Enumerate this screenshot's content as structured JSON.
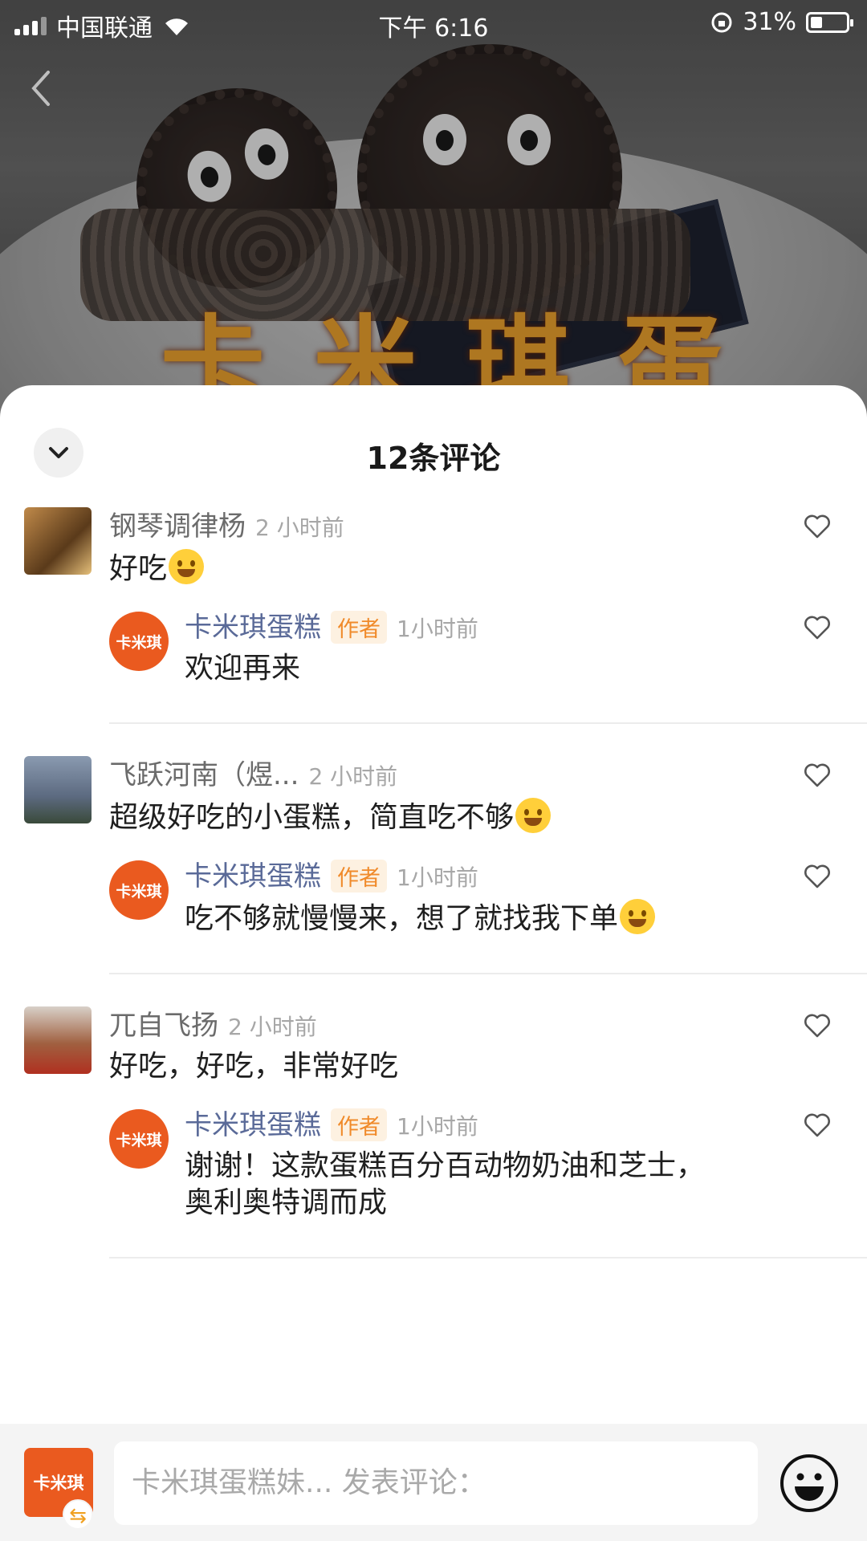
{
  "status_bar": {
    "carrier": "中国联通",
    "time": "下午 6:16",
    "battery": "31%"
  },
  "hero": {
    "brand_overlay": "卡米琪蛋糕"
  },
  "sheet": {
    "title": "12条评论"
  },
  "comments": [
    {
      "user": "钢琴调律杨",
      "time": "2 小时前",
      "text": "好吃",
      "reply": {
        "user": "卡米琪蛋糕",
        "tag": "作者",
        "time": "1小时前",
        "text": "欢迎再来"
      }
    },
    {
      "user": "飞跃河南（煜...",
      "time": "2 小时前",
      "text": "超级好吃的小蛋糕，简直吃不够",
      "reply": {
        "user": "卡米琪蛋糕",
        "tag": "作者",
        "time": "1小时前",
        "text": "吃不够就慢慢来，想了就找我下单"
      }
    },
    {
      "user": "兀自飞扬",
      "time": "2 小时前",
      "text": "好吃，好吃，非常好吃",
      "reply": {
        "user": "卡米琪蛋糕",
        "tag": "作者",
        "time": "1小时前",
        "text_line1": "谢谢！这款蛋糕百分百动物奶油和芝士，",
        "text_line2": "奥利奥特调而成"
      }
    }
  ],
  "author_avatar_text": "卡米琪",
  "input_bar": {
    "avatar_text": "卡米琪",
    "switch_icon": "⇆",
    "placeholder": "卡米琪蛋糕妹... 发表评论："
  },
  "icons": [
    "back-chevron-icon",
    "chevron-down-icon",
    "heart-outline-icon",
    "smiley-icon",
    "wifi-icon",
    "signal-icon",
    "battery-icon",
    "rotation-lock-icon"
  ]
}
